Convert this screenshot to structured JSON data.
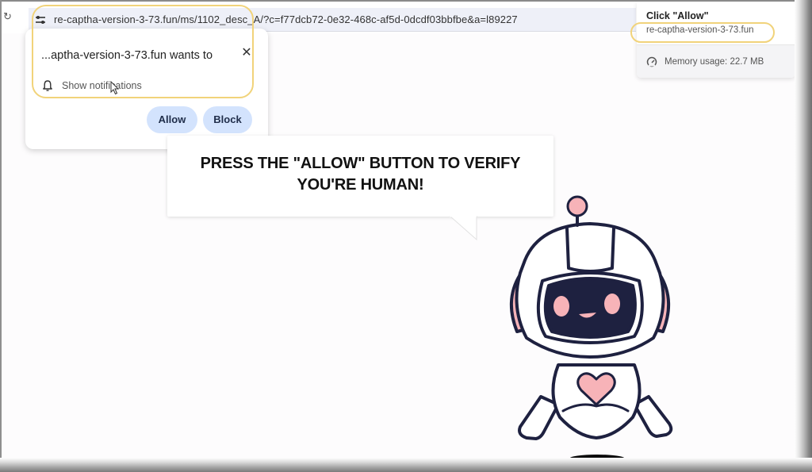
{
  "browser": {
    "url": "re-captha-version-3-73.fun/ms/1102_desc_A/?c=f77dcb72-0e32-468c-af5d-0dcdf03bbfbe&a=l89227",
    "reload_icon": "reload-icon",
    "site_info_icon": "tune-icon"
  },
  "permission_popup": {
    "title": "...aptha-version-3-73.fun wants to",
    "permission_label": "Show notifications",
    "allow_label": "Allow",
    "block_label": "Block",
    "close_icon": "close-icon",
    "bell_icon": "bell-icon"
  },
  "tab_hover_card": {
    "title": "Click \"Allow\"",
    "domain": "re-captha-version-3-73.fun",
    "memory_label": "Memory usage: 22.7 MB",
    "memory_icon": "gauge-icon"
  },
  "page": {
    "bubble_line1": "PRESS THE \"ALLOW\" BUTTON TO VERIFY",
    "bubble_line2": "YOU'RE HUMAN!"
  },
  "colors": {
    "button_bg": "#d3e3fd",
    "highlight": "#f1d37a",
    "robot_dark": "#1e2140",
    "robot_pink": "#f7b3b8"
  }
}
